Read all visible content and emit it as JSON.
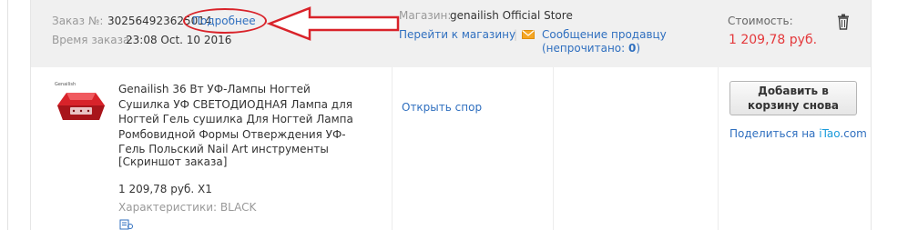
{
  "order": {
    "number_label": "Заказ №:",
    "number_value": "302564923625014",
    "details_link": "Подробнее",
    "time_label": "Время заказа:",
    "time_value": "23:08 Oct. 10 2016"
  },
  "store": {
    "label": "Магазин:",
    "name": "genailish Official Store",
    "goto_link": "Перейти к магазину",
    "separator": "|",
    "message_link": "Сообщение продавцу",
    "unread_prefix": "(непрочитано: ",
    "unread_count": "0",
    "unread_suffix": ")"
  },
  "cost": {
    "label": "Стоимость:",
    "value": "1 209,78 руб."
  },
  "product": {
    "title": "Genailish 36 Вт УФ-Лампы Ногтей Сушилка УФ СВЕТОДИОДНАЯ Лампа для Ногтей Гель сушилка Для Ногтей Лампа Ромбовидной Формы Отверждения УФ-Гель Польский Nail Art инструменты",
    "screenshot_link": "[Скриншот заказа]",
    "price_qty": "1 209,78 руб. X1",
    "attributes": "Характеристики: BLACK"
  },
  "actions": {
    "dispute_link": "Открыть спор",
    "add_to_cart": "Добавить в корзину снова",
    "share_prefix": "Поделиться на ",
    "share_brand": "iTao",
    "share_suffix": ".com"
  },
  "colors": {
    "accent_link": "#2f6fbf",
    "price_red": "#e4393c",
    "annotation_red": "#d9232a"
  },
  "icons": [
    "mail-icon",
    "trash-icon",
    "snapshot-icon",
    "annotation-arrow"
  ]
}
